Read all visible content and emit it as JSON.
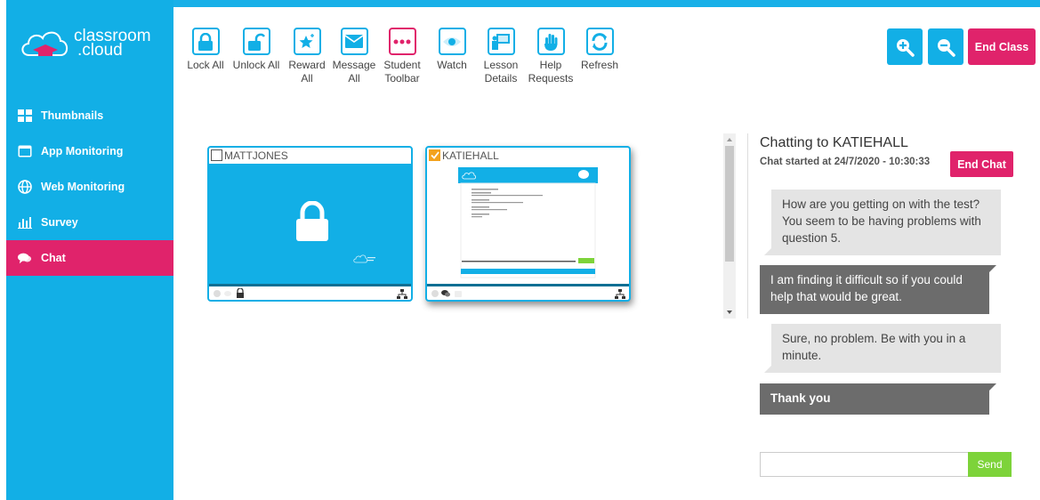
{
  "app": {
    "logo_line1": "classroom",
    "logo_line2": ".cloud"
  },
  "colors": {
    "brand_blue": "#12afe6",
    "accent_pink": "#e0236b",
    "send_green": "#7dd33a",
    "check_orange": "#f3a21d"
  },
  "sidebar": {
    "items": [
      {
        "label": "Thumbnails",
        "icon": "grid-icon"
      },
      {
        "label": "App Monitoring",
        "icon": "window-icon"
      },
      {
        "label": "Web Monitoring",
        "icon": "globe-icon"
      },
      {
        "label": "Survey",
        "icon": "bar-chart-icon"
      },
      {
        "label": "Chat",
        "icon": "chat-bubbles-icon",
        "active": true
      }
    ]
  },
  "toolbar": {
    "lock_all": [
      "Lock All",
      ""
    ],
    "unlock_all": [
      "Unlock All",
      ""
    ],
    "reward_all": [
      "Reward",
      "All"
    ],
    "message_all": [
      "Message",
      "All"
    ],
    "student_toolbar": [
      "Student",
      "Toolbar"
    ],
    "watch": [
      "Watch",
      ""
    ],
    "lesson_details": [
      "Lesson",
      "Details"
    ],
    "help_requests": [
      "Help",
      "Requests"
    ],
    "refresh": [
      "Refresh",
      ""
    ]
  },
  "header": {
    "end_class": "End Class",
    "zoom_in_icon": "zoom-in-icon",
    "zoom_out_icon": "zoom-out-icon"
  },
  "students": [
    {
      "name": "MATTJONES",
      "checked": false,
      "locked": true
    },
    {
      "name": "KATIEHALL",
      "checked": true,
      "locked": false
    }
  ],
  "chat": {
    "title_prefix": "Chatting to ",
    "student": "KATIEHALL",
    "started": "Chat started at 24/7/2020 - 10:30:33",
    "end_chat": "End Chat",
    "messages": [
      {
        "from": "teacher",
        "text": "How are you getting on with the test? You seem to be having problems with question 5."
      },
      {
        "from": "student",
        "text": "I am finding it difficult so if you could help that would be great."
      },
      {
        "from": "teacher",
        "text": "Sure, no problem. Be with you in a minute."
      },
      {
        "from": "student",
        "text": "Thank you"
      }
    ],
    "input_value": "",
    "send": "Send"
  }
}
